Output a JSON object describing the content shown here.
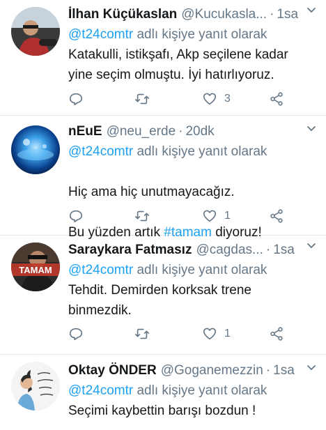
{
  "tweets": [
    {
      "name": "İlhan Küçükaslan",
      "handle": "@Kucukasla...",
      "time": "1sa",
      "reply_prefix": "@t24comtr",
      "reply_suffix": " adlı kişiye yanıt olarak",
      "text": "Katakulli, istikşafı, Akp seçilene kadar\nyine seçim olmuştu. İyi hatırlıyoruz.",
      "likes": "3",
      "avatar_icon": "driver-photo"
    },
    {
      "name": "nEuE",
      "handle": "@neu_erde",
      "time": "20dk",
      "reply_prefix": "@t24comtr",
      "reply_suffix": " adlı kişiye yanıt olarak",
      "text_line1": "Hiç ama hiç unutmayacağız.",
      "text_line2_pre": "Bu yüzden artık ",
      "hashtag": "#tamam",
      "text_line2_post": " diyoruz!",
      "likes": "1",
      "avatar_icon": "blue-planet-image"
    },
    {
      "name": "Saraykara Fatmasız",
      "handle": "@cagdas...",
      "time": "1sa",
      "reply_prefix": "@t24comtr",
      "reply_suffix": " adlı kişiye yanıt olarak",
      "text": "Tehdit. Demirden korksak trene\nbinmezdik.",
      "likes": "1",
      "avatar_text": "TAMAM",
      "avatar_icon": "tamam-portrait"
    },
    {
      "name": "Oktay ÖNDER",
      "handle": "@Goganemezzin",
      "time": "1sa",
      "reply_prefix": "@t24comtr",
      "reply_suffix": " adlı kişiye yanıt olarak",
      "text": "Seçimi kaybettin barışı bozdun !",
      "avatar_icon": "handwritten-sign-portrait"
    }
  ],
  "separator": "·",
  "icons": {
    "reply": "reply-icon",
    "retweet": "retweet-icon",
    "like": "heart-icon",
    "share": "share-icon",
    "menu": "chevron-down-icon"
  },
  "colors": {
    "accent": "#1da1f2",
    "muted": "#657786",
    "text": "#14171a",
    "divider": "#e1e8ed"
  }
}
